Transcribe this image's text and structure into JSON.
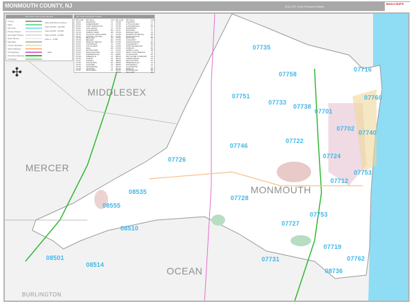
{
  "header": {
    "title": "MONMOUTH COUNTY, NJ",
    "edition": "2021 ZIP Code Premium Edition",
    "logo_text": "Market MAPS"
  },
  "legend": {
    "title": "2021 Monmouth County Zip Map",
    "items": [
      "County",
      "State",
      "ZIP Code",
      "Primary Streets",
      "Secondary Streets",
      "Minor Streets",
      "Rail Ways",
      "County Highways",
      "State Highways",
      "US Highways",
      "Interstate Highways",
      "Toll Roads"
    ],
    "cities": [
      "Cities 250,000 and Above",
      "Cities 50,000 - 249,999",
      "Cities 25,000 - 49,999",
      "Cities 10,000 - 24,999",
      "Cities 1 - 9,999"
    ],
    "scale_label": "Miles"
  },
  "colors": {
    "ocean": "#8fdcf5",
    "land": "#f2f2f2",
    "county": "#ffffff",
    "zip_label": "#3fb6e8",
    "interstate": "#2eb82e",
    "us_highway": "#e66ccd",
    "state_highway": "#f5c08a",
    "urban": "#d9a7a3",
    "park": "#b8dcc4"
  },
  "index": {
    "title": "ZIP Codes Index/Post Location",
    "headers": [
      "ZIP Code",
      "ZIP Name",
      "LOC"
    ],
    "rows": [
      [
        "07701",
        "RED BANK",
        "L2"
      ],
      [
        "07702",
        "SHREWSBURY",
        "L3"
      ],
      [
        "07703",
        "FORT MONMOUTH",
        "L3"
      ],
      [
        "07704",
        "FAIR HAVEN",
        "L2"
      ],
      [
        "07711",
        "ALLENHURST",
        "M3"
      ],
      [
        "07712",
        "ASBURY PARK",
        "M3"
      ],
      [
        "07716",
        "ATLANTIC HIGHLANDS",
        "L1"
      ],
      [
        "07717",
        "AVON BY THE SEA",
        "M4"
      ],
      [
        "07718",
        "BELFORD",
        "K1"
      ],
      [
        "07719",
        "BELMAR",
        "M4"
      ],
      [
        "07720",
        "BRADLEY BEACH",
        "M4"
      ],
      [
        "07721",
        "CLIFFWOOD",
        "J1"
      ],
      [
        "07722",
        "COLTS NECK",
        "K3"
      ],
      [
        "07723",
        "DEAL",
        "M3"
      ],
      [
        "07724",
        "EATONTOWN",
        "L3"
      ],
      [
        "07726",
        "ENGLISHTOWN",
        "H3"
      ],
      [
        "07727",
        "FARMINGDALE",
        "K4"
      ],
      [
        "07728",
        "FREEHOLD",
        "J4"
      ],
      [
        "07730",
        "HAZLET",
        "K1"
      ],
      [
        "07731",
        "HOWELL",
        "K5"
      ],
      [
        "07732",
        "HIGHLANDS",
        "M1"
      ],
      [
        "07733",
        "HOLMDEL",
        "K2"
      ],
      [
        "07734",
        "KEANSBURG",
        "K1"
      ],
      [
        "07735",
        "KEYPORT",
        "J1"
      ],
      [
        "07737",
        "LEONARDO",
        "L1"
      ],
      [
        "07738",
        "LINCROFT",
        "L2"
      ],
      [
        "07739",
        "LITTLE SILVER",
        "L2"
      ],
      [
        "07740",
        "LONG BRANCH",
        "M3"
      ],
      [
        "07746",
        "MARLBORO",
        "J2"
      ],
      [
        "07747",
        "MATAWAN",
        "J1"
      ],
      [
        "07748",
        "MIDDLETOWN",
        "K2"
      ],
      [
        "07750",
        "MONMOUTH BEACH",
        "M2"
      ],
      [
        "07751",
        "MORGANVILLE",
        "J2"
      ],
      [
        "07753",
        "NEPTUNE",
        "M4"
      ],
      [
        "07755",
        "OAKHURST",
        "L3"
      ],
      [
        "07756",
        "OCEAN GROVE",
        "M4"
      ],
      [
        "07757",
        "OCEANPORT",
        "M2"
      ],
      [
        "07758",
        "PORT MONMOUTH",
        "K1"
      ],
      [
        "07760",
        "RUMSON",
        "M2"
      ],
      [
        "07762",
        "SPRING LAKE",
        "M5"
      ],
      [
        "07764",
        "WEST LONG BRANCH",
        "L3"
      ],
      [
        "08501",
        "ALLENTOWN",
        "E5"
      ],
      [
        "08510",
        "MILLSTONE TOWNSHIP",
        "G4"
      ],
      [
        "08514",
        "CREAM RIDGE",
        "F5"
      ],
      [
        "08526",
        "IMLAYSTOWN",
        "F5"
      ],
      [
        "08535",
        "PERRINEVILLE",
        "G4"
      ],
      [
        "08555",
        "ROOSEVELT",
        "F4"
      ],
      [
        "08720",
        "ALLENWOOD",
        "L5"
      ],
      [
        "08730",
        "BRIELLE",
        "M5"
      ],
      [
        "08736",
        "MANASQUAN",
        "M5"
      ],
      [
        "08750",
        "SEA GIRT",
        "M5"
      ]
    ]
  },
  "counties": [
    "MIDDLESEX",
    "MERCER",
    "MONMOUTH",
    "OCEAN",
    "BURLINGTON"
  ],
  "zips": [
    "07735",
    "07716",
    "07758",
    "07751",
    "07733",
    "07738",
    "07701",
    "07760",
    "07740",
    "07702",
    "07722",
    "07746",
    "07724",
    "07726",
    "07753",
    "07712",
    "07728",
    "07727",
    "07753",
    "08535",
    "08555",
    "08510",
    "07731",
    "07719",
    "07762",
    "08501",
    "08514",
    "08736"
  ]
}
